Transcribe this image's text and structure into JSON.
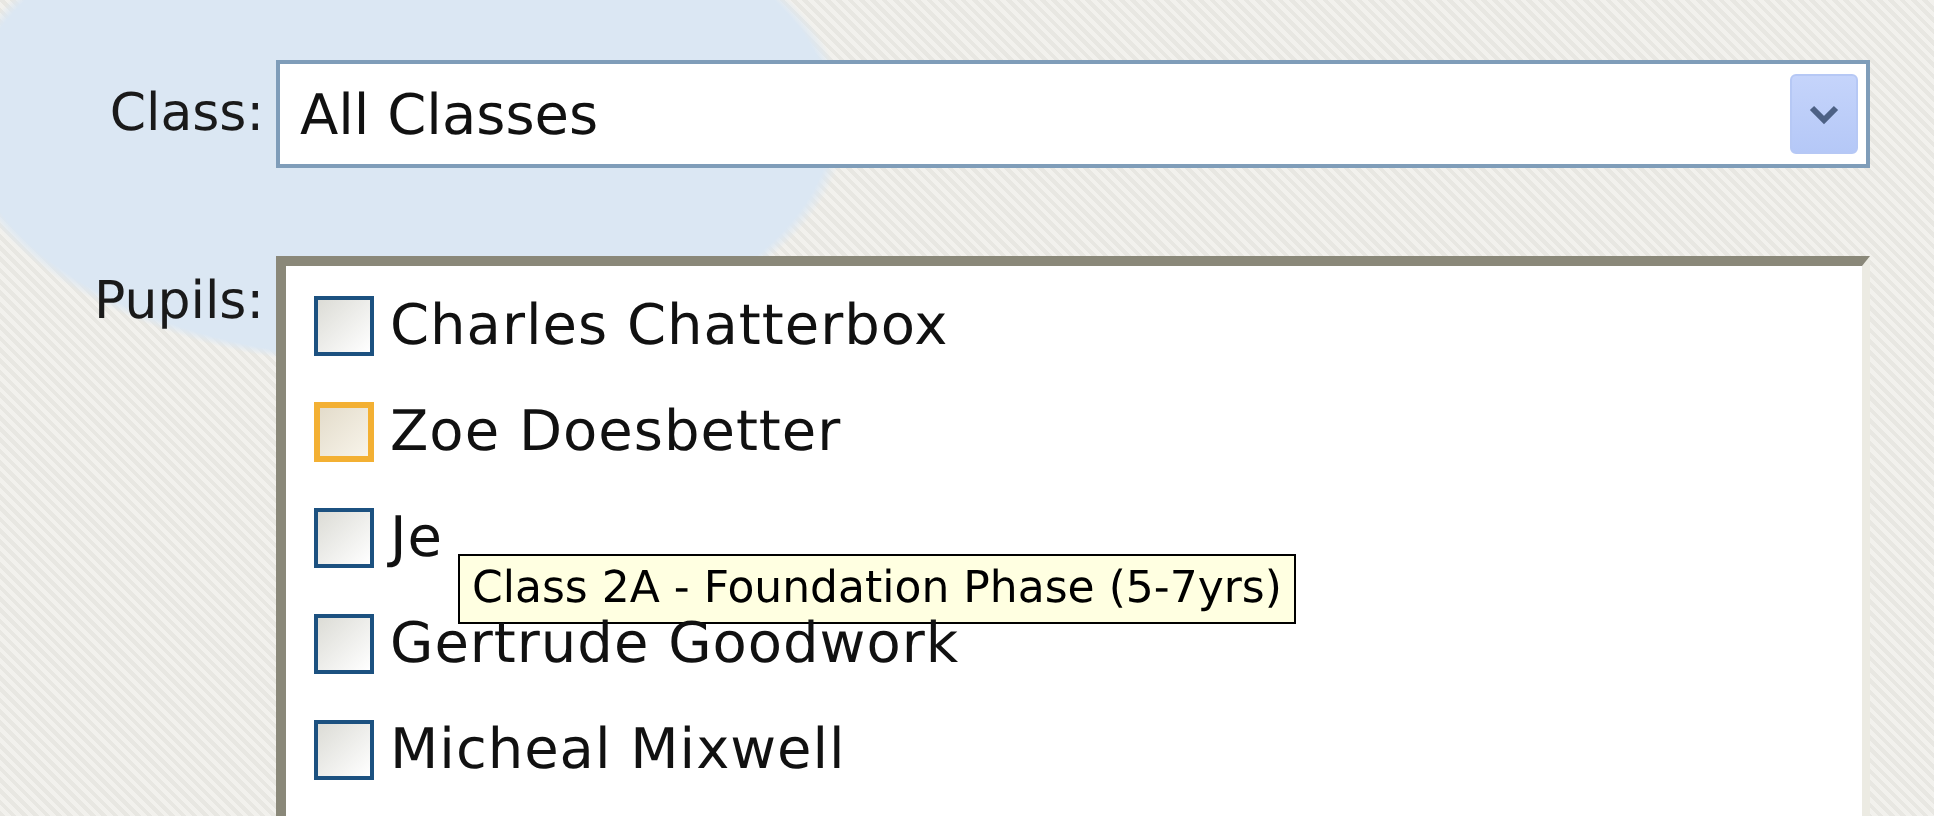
{
  "class_field": {
    "label": "Class:",
    "value": "All Classes"
  },
  "pupils": {
    "label": "Pupils:",
    "items": [
      {
        "name": "Charles Chatterbox",
        "checked": false,
        "hovered": false
      },
      {
        "name": "Zoe Doesbetter",
        "checked": false,
        "hovered": true
      },
      {
        "name": "Je",
        "checked": false,
        "hovered": false,
        "tooltip": "Class 2A - Foundation Phase (5-7yrs)"
      },
      {
        "name": "Gertrude Goodwork",
        "checked": false,
        "hovered": false
      },
      {
        "name": "Micheal Mixwell",
        "checked": false,
        "hovered": false
      }
    ]
  }
}
